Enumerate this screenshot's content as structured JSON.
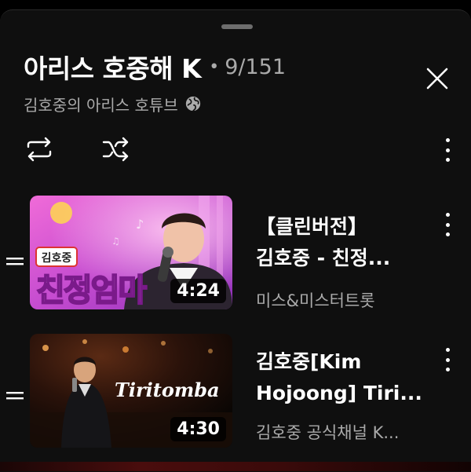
{
  "playlist": {
    "title": "아리스 호중해 K",
    "separator": "•",
    "position": "9/151",
    "channel": "김호중의 아리스 호튜브"
  },
  "icons": {
    "close": "close-icon",
    "globe": "globe-icon",
    "loop": "loop-icon",
    "shuffle": "shuffle-icon",
    "more": "more-vert-icon",
    "drag": "drag-handle-icon"
  },
  "items": [
    {
      "title_line1": "【클린버전】",
      "title_line2": "김호중 - 친정...",
      "channel": "미스&미스터트롯",
      "duration": "4:24",
      "thumb_badge": "김호중",
      "thumb_text": "친정엄마"
    },
    {
      "title_line1": "김호중[Kim",
      "title_line2": "Hojoong] Tiri...",
      "channel": "김호중 공식채널 K...",
      "duration": "4:30",
      "thumb_text": "Tiritomba"
    }
  ],
  "colors": {
    "background": "#0f0f0f",
    "text_primary": "#ffffff",
    "text_secondary": "#aaaaaa"
  }
}
